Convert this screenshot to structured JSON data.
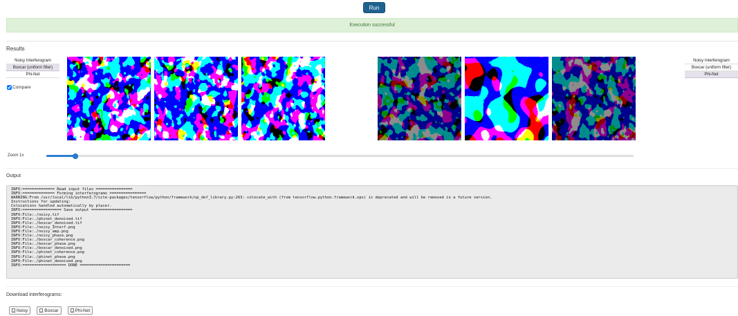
{
  "toolbar": {
    "run_label": "Run"
  },
  "status": {
    "message": "Execution successful",
    "color": "#3c763d"
  },
  "results": {
    "title": "Results",
    "left_list": [
      "Noisy Interferogram",
      "Boxcar (uniform filter)",
      "Phi-Net"
    ],
    "left_selected": 1,
    "right_list": [
      "Noisy Interferogram",
      "Boxcar (uniform filter)",
      "Phi-Net"
    ],
    "right_selected": 2,
    "compare_label": "Compare",
    "compare_checked": true,
    "images": [
      {
        "kind": "amplitude-gray"
      },
      {
        "kind": "phase-rainbow"
      },
      {
        "kind": "phase-rainbow-noisy"
      },
      {
        "kind": "amplitude-gray-dark"
      },
      {
        "kind": "phase-rainbow-smooth"
      },
      {
        "kind": "phase-rainbow-dark"
      }
    ]
  },
  "zoom": {
    "label": "Zoom 1x",
    "value": 0.05
  },
  "output": {
    "title": "Output",
    "lines": [
      "INFO:============== Read input files ================",
      "INFO:============== Forming interferograms ================",
      "WARNING:From /usr/local/lib/python3.7/site-packages/tensorflow/python/framework/op_def_library.py:263: colocate_with (from tensorflow.python.framework.ops) is deprecated and will be removed in a future version.",
      "Instructions for updating:",
      "Colocations handled automatically by placer.",
      "INFO:================= Save output ==================",
      "INFO:File:./noisy.tif",
      "INFO:File:./phinet_denoised.tif",
      "INFO:File:./boxcar_denoised.tif",
      "INFO:File:./noisy_Interf.png",
      "INFO:File:./noisy_amp.png",
      "INFO:File:./noisy_phase.png",
      "INFO:File:./boxcar_coherence.png",
      "INFO:File:./boxcar_phase.png",
      "INFO:File:./boxcar_denoised.png",
      "INFO:File:./phinet_coherence.png",
      "INFO:File:./phinet_phase.png",
      "INFO:File:./phinet_denoised.png",
      "INFO:=================== DONE ======================"
    ]
  },
  "download": {
    "title": "Download Interferograms:",
    "buttons": [
      "Noisy",
      "Boxcar",
      "Phi-Net"
    ],
    "icon": "file-icon"
  },
  "colors": {
    "run_button": "#1f6290",
    "alert_bg": "#dff0d8",
    "slider_accent": "#2a7fd4"
  }
}
